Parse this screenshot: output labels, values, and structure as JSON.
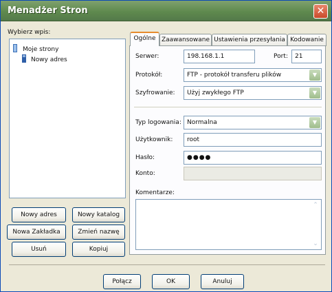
{
  "window": {
    "title": "Menadżer Stron",
    "close_glyph": "✕"
  },
  "left": {
    "label": "Wybierz wpis:",
    "tree": [
      {
        "label": "Moje strony",
        "icon": "folder-icon"
      },
      {
        "label": "Nowy adres",
        "icon": "server-icon",
        "selected": true
      }
    ],
    "buttons": {
      "new_site": "Nowy adres",
      "new_folder": "Nowy katalog",
      "new_bookmark": "Nowa Zakładka",
      "rename": "Zmień nazwę",
      "delete": "Usuń",
      "copy": "Kopiuj"
    }
  },
  "tabs": [
    {
      "label": "Ogólne",
      "active": true
    },
    {
      "label": "Zaawansowane"
    },
    {
      "label": "Ustawienia przesyłania"
    },
    {
      "label": "Kodowanie"
    }
  ],
  "general": {
    "host_label": "Serwer:",
    "host_value": "198.168.1.1",
    "port_label": "Port:",
    "port_value": "21",
    "protocol_label": "Protokół:",
    "protocol_value": "FTP - protokół transferu plików",
    "encryption_label": "Szyfrowanie:",
    "encryption_value": "Użyj zwykłego FTP",
    "logon_label": "Typ logowania:",
    "logon_value": "Normalna",
    "user_label": "Użytkownik:",
    "user_value": "root",
    "password_label": "Hasło:",
    "password_value": "●●●●",
    "account_label": "Konto:",
    "account_value": "",
    "comments_label": "Komentarze:",
    "comments_value": ""
  },
  "footer": {
    "connect": "Połącz",
    "ok": "OK",
    "cancel": "Anuluj"
  }
}
